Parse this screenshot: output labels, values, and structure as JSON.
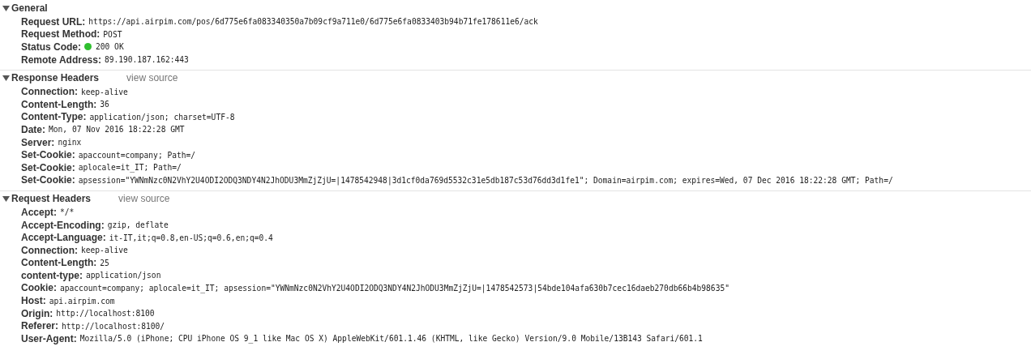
{
  "sections": [
    {
      "title": "General",
      "expanded": true,
      "rows": [
        {
          "name": "Request URL:",
          "value": "https://api.airpim.com/pos/6d775e6fa083340350a7b09cf9a711e0/6d775e6fa0833403b94b71fe178611e6/ack"
        },
        {
          "name": "Request Method:",
          "value": "POST"
        },
        {
          "name": "Status Code:",
          "value": "200 OK",
          "color": "#2fbf2f"
        },
        {
          "name": "Remote Address:",
          "value": "89.190.187.162:443"
        }
      ]
    },
    {
      "title": "Response Headers",
      "expanded": true,
      "link": "view source",
      "rows": [
        {
          "name": "Connection:",
          "value": "keep-alive"
        },
        {
          "name": "Content-Length:",
          "value": "36"
        },
        {
          "name": "Content-Type:",
          "value": "application/json; charset=UTF-8"
        },
        {
          "name": "Date:",
          "value": "Mon, 07 Nov 2016 18:22:28 GMT"
        },
        {
          "name": "Server:",
          "value": "nginx"
        },
        {
          "name": "Set-Cookie:",
          "value": "apaccount=company; Path=/"
        },
        {
          "name": "Set-Cookie:",
          "value": "aplocale=it_IT; Path=/"
        },
        {
          "name": "Set-Cookie:",
          "value": "apsession=\"YWNmNzc0N2VhY2U4ODI2ODQ3NDY4N2JhODU3MmZjZjU=|1478542948|3d1cf0da769d5532c31e5db187c53d76dd3d1fe1\"; Domain=airpim.com; expires=Wed, 07 Dec 2016 18:22:28 GMT; Path=/"
        }
      ]
    },
    {
      "title": "Request Headers",
      "expanded": true,
      "link": "view source",
      "rows": [
        {
          "name": "Accept:",
          "value": "*/*"
        },
        {
          "name": "Accept-Encoding:",
          "value": "gzip, deflate"
        },
        {
          "name": "Accept-Language:",
          "value": "it-IT,it;q=0.8,en-US;q=0.6,en;q=0.4"
        },
        {
          "name": "Connection:",
          "value": "keep-alive"
        },
        {
          "name": "Content-Length:",
          "value": "25"
        },
        {
          "name": "content-type:",
          "value": "application/json"
        },
        {
          "name": "Cookie:",
          "value": "apaccount=company; aplocale=it_IT; apsession=\"YWNmNzc0N2VhY2U4ODI2ODQ3NDY4N2JhODU3MmZjZjU=|1478542573|54bde104afa630b7cec16daeb270db66b4b98635\""
        },
        {
          "name": "Host:",
          "value": "api.airpim.com"
        },
        {
          "name": "Origin:",
          "value": "http://localhost:8100"
        },
        {
          "name": "Referer:",
          "value": "http://localhost:8100/"
        },
        {
          "name": "User-Agent:",
          "value": "Mozilla/5.0 (iPhone; CPU iPhone OS 9_1 like Mac OS X) AppleWebKit/601.1.46 (KHTML, like Gecko) Version/9.0 Mobile/13B143 Safari/601.1"
        }
      ]
    }
  ]
}
